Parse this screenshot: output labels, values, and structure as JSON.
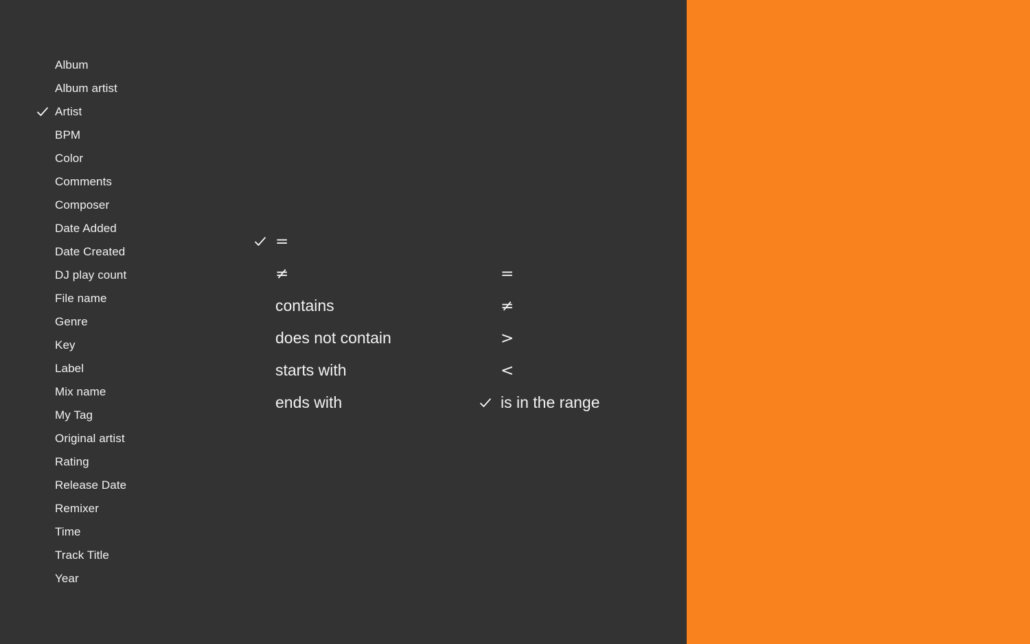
{
  "theme": {
    "menu_background": "#333333",
    "menu_text": "#f2f2f2",
    "check_color": "#ffffff",
    "accent_panel": "#f9821e"
  },
  "field_menu": {
    "name": "filter-field-menu",
    "items": [
      {
        "label": "Album",
        "checked": false
      },
      {
        "label": "Album artist",
        "checked": false
      },
      {
        "label": "Artist",
        "checked": true
      },
      {
        "label": "BPM",
        "checked": false
      },
      {
        "label": "Color",
        "checked": false
      },
      {
        "label": "Comments",
        "checked": false
      },
      {
        "label": "Composer",
        "checked": false
      },
      {
        "label": "Date Added",
        "checked": false
      },
      {
        "label": "Date Created",
        "checked": false
      },
      {
        "label": "DJ play count",
        "checked": false
      },
      {
        "label": "File name",
        "checked": false
      },
      {
        "label": "Genre",
        "checked": false
      },
      {
        "label": "Key",
        "checked": false
      },
      {
        "label": "Label",
        "checked": false
      },
      {
        "label": "Mix name",
        "checked": false
      },
      {
        "label": "My Tag",
        "checked": false
      },
      {
        "label": "Original artist",
        "checked": false
      },
      {
        "label": "Rating",
        "checked": false
      },
      {
        "label": "Release Date",
        "checked": false
      },
      {
        "label": "Remixer",
        "checked": false
      },
      {
        "label": "Time",
        "checked": false
      },
      {
        "label": "Track Title",
        "checked": false
      },
      {
        "label": "Year",
        "checked": false
      }
    ]
  },
  "operator_menu": {
    "name": "string-operator-menu",
    "items": [
      {
        "label": "=",
        "checked": true
      },
      {
        "label": "≠",
        "checked": false
      },
      {
        "label": "contains",
        "checked": false
      },
      {
        "label": "does not contain",
        "checked": false
      },
      {
        "label": "starts with",
        "checked": false
      },
      {
        "label": "ends with",
        "checked": false
      }
    ]
  },
  "range_menu": {
    "name": "numeric-operator-menu",
    "items": [
      {
        "label": "=",
        "checked": false
      },
      {
        "label": "≠",
        "checked": false
      },
      {
        "label": ">",
        "checked": false
      },
      {
        "label": "<",
        "checked": false
      },
      {
        "label": "is in the range",
        "checked": true
      }
    ]
  }
}
